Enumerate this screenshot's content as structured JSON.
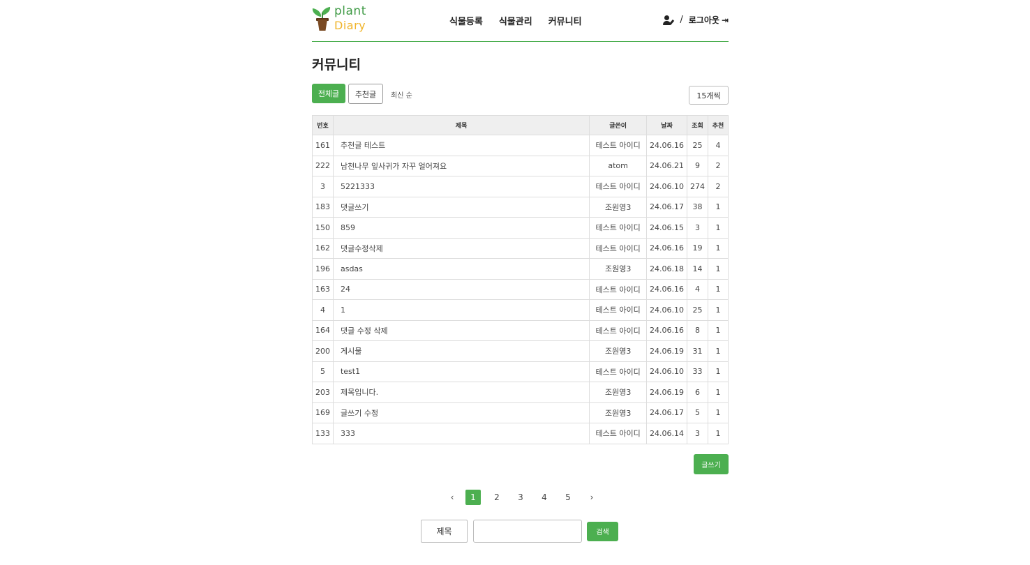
{
  "brand": {
    "word1": "plant",
    "word2": "Diary",
    "green": "#4caf50",
    "yellow": "#f0b429"
  },
  "nav": {
    "items": [
      "식물등록",
      "식물관리",
      "커뮤니티"
    ]
  },
  "user": {
    "separator": "/",
    "logout_label": "로그아웃",
    "user_icon": "user-edit-icon",
    "logout_icon": "sign-out-icon"
  },
  "page": {
    "title": "커뮤니티"
  },
  "filters": {
    "all_label": "전체글",
    "recommended_label": "추천글",
    "sort_label": "최신 순",
    "per_page": "15개씩"
  },
  "table": {
    "headers": [
      "번호",
      "제목",
      "글쓴이",
      "날짜",
      "조회",
      "추천"
    ],
    "rows": [
      [
        "161",
        "추천글 테스트",
        "테스트 아이디",
        "24.06.16",
        "25",
        "4"
      ],
      [
        "222",
        "남천나무 잎사귀가 자꾸 얼어져요",
        "atom",
        "24.06.21",
        "9",
        "2"
      ],
      [
        "3",
        "5221333",
        "테스트 아이디",
        "24.06.10",
        "274",
        "2"
      ],
      [
        "183",
        "댓글쓰기",
        "조원영3",
        "24.06.17",
        "38",
        "1"
      ],
      [
        "150",
        "859",
        "테스트 아이디",
        "24.06.15",
        "3",
        "1"
      ],
      [
        "162",
        "댓글수정삭제",
        "테스트 아이디",
        "24.06.16",
        "19",
        "1"
      ],
      [
        "196",
        "asdas",
        "조원영3",
        "24.06.18",
        "14",
        "1"
      ],
      [
        "163",
        "24",
        "테스트 아이디",
        "24.06.16",
        "4",
        "1"
      ],
      [
        "4",
        "1",
        "테스트 아이디",
        "24.06.10",
        "25",
        "1"
      ],
      [
        "164",
        "댓글 수정 삭제",
        "테스트 아이디",
        "24.06.16",
        "8",
        "1"
      ],
      [
        "200",
        "게시물",
        "조원영3",
        "24.06.19",
        "31",
        "1"
      ],
      [
        "5",
        "test1",
        "테스트 아이디",
        "24.06.10",
        "33",
        "1"
      ],
      [
        "203",
        "제목입니다.",
        "조원영3",
        "24.06.19",
        "6",
        "1"
      ],
      [
        "169",
        "글쓰기 수정",
        "조원영3",
        "24.06.17",
        "5",
        "1"
      ],
      [
        "133",
        "333",
        "테스트 아이디",
        "24.06.14",
        "3",
        "1"
      ]
    ]
  },
  "write_label": "글쓰기",
  "pagination": {
    "prev": "‹",
    "next": "›",
    "pages": [
      "1",
      "2",
      "3",
      "4",
      "5"
    ],
    "current": "1"
  },
  "search": {
    "field_label": "제목",
    "input_value": "",
    "button_label": "검색"
  }
}
